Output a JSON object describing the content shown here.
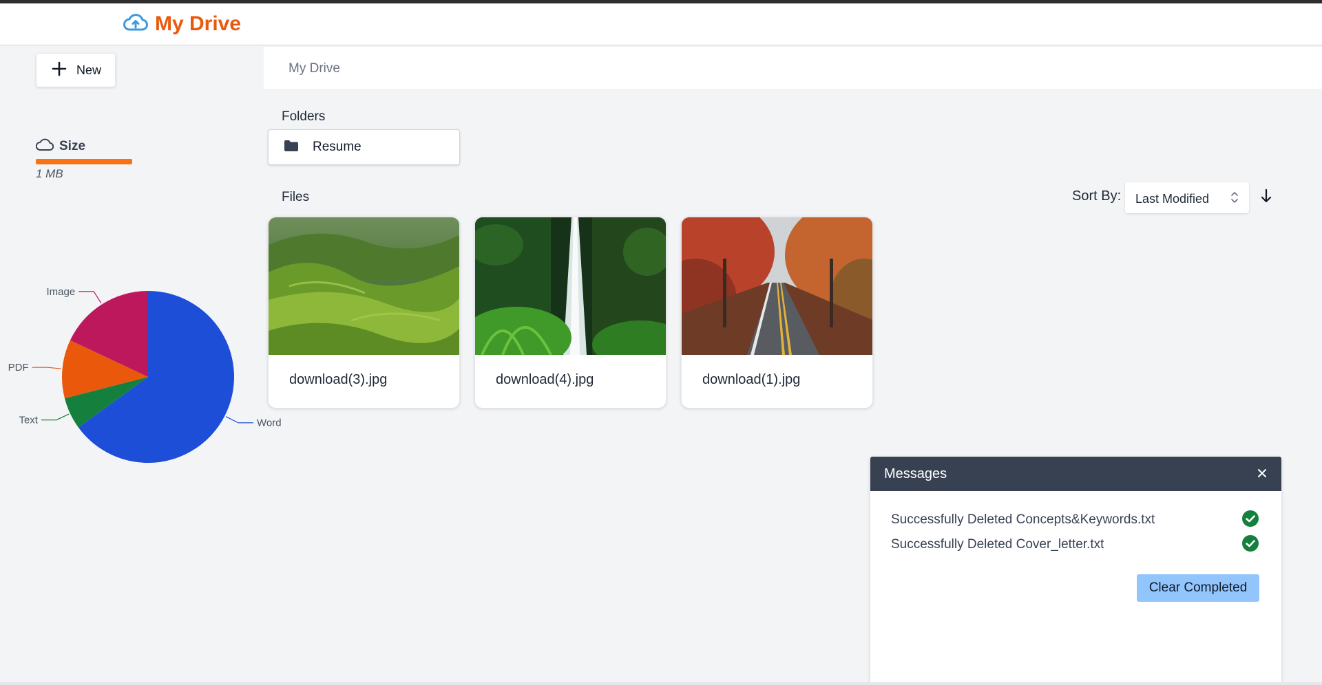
{
  "app": {
    "title": "My Drive",
    "brand_color": "#ea580c",
    "icon": "cloud-upload-icon"
  },
  "sidebar": {
    "new_label": "New",
    "storage": {
      "label": "Size",
      "value": "1 MB",
      "bar_color": "#f97316"
    }
  },
  "chart_data": {
    "type": "pie",
    "slices": [
      {
        "label": "Word",
        "value": 65,
        "color": "#1d4ed8"
      },
      {
        "label": "Text",
        "value": 6,
        "color": "#15803d"
      },
      {
        "label": "PDF",
        "value": 11,
        "color": "#ea580c"
      },
      {
        "label": "Image",
        "value": 18,
        "color": "#be185d"
      }
    ]
  },
  "breadcrumb": {
    "current": "My Drive"
  },
  "folders": {
    "heading": "Folders",
    "items": [
      {
        "name": "Resume",
        "icon": "folder-icon"
      }
    ]
  },
  "files": {
    "heading": "Files",
    "items": [
      {
        "name": "download(3).jpg",
        "scene": "green hills"
      },
      {
        "name": "download(4).jpg",
        "scene": "waterfall"
      },
      {
        "name": "download(1).jpg",
        "scene": "autumn road"
      }
    ]
  },
  "sort": {
    "label": "Sort By:",
    "selected": "Last Modified",
    "direction_icon": "arrow-down-icon"
  },
  "messages": {
    "title": "Messages",
    "items": [
      {
        "text": "Successfully Deleted Concepts&Keywords.txt",
        "status": "success"
      },
      {
        "text": "Successfully Deleted Cover_letter.txt",
        "status": "success"
      }
    ],
    "clear_label": "Clear Completed"
  }
}
